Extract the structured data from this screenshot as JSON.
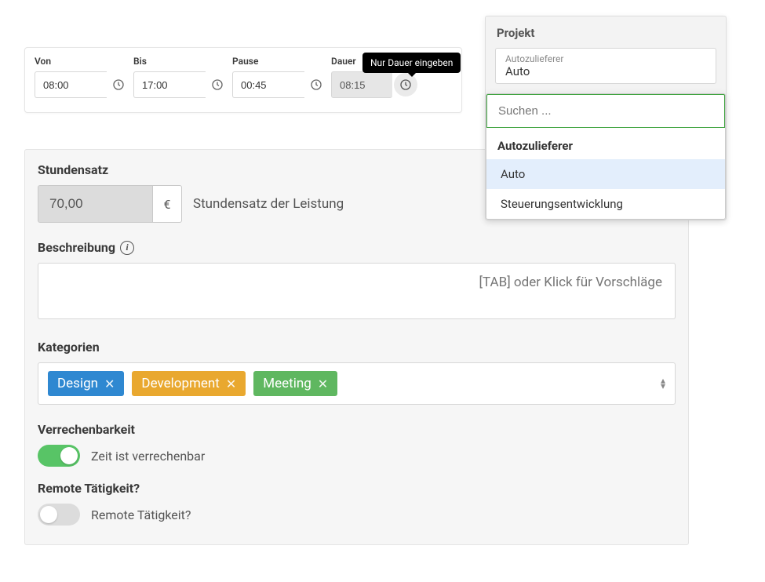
{
  "time": {
    "labels": {
      "von": "Von",
      "bis": "Bis",
      "pause": "Pause",
      "dauer": "Dauer"
    },
    "values": {
      "von": "08:00",
      "bis": "17:00",
      "pause": "00:45",
      "dauer": "08:15"
    },
    "tooltip": "Nur Dauer eingeben"
  },
  "rate": {
    "label": "Stundensatz",
    "value": "70,00",
    "currency": "€",
    "hint": "Stundensatz der Leistung"
  },
  "description": {
    "label": "Beschreibung",
    "placeholder": "[TAB] oder Klick für Vorschläge"
  },
  "categories": {
    "label": "Kategorien",
    "tags": [
      {
        "label": "Design",
        "color": "blue"
      },
      {
        "label": "Development",
        "color": "yellow"
      },
      {
        "label": "Meeting",
        "color": "green"
      }
    ]
  },
  "billable": {
    "label": "Verrechenbarkeit",
    "text": "Zeit ist verrechenbar",
    "on": true
  },
  "remote": {
    "label": "Remote Tätigkeit?",
    "text": "Remote Tätigkeit?",
    "on": false
  },
  "project": {
    "header": "Projekt",
    "selected_sub": "Autozulieferer",
    "selected_main": "Auto",
    "search_placeholder": "Suchen ...",
    "group_title": "Autozulieferer",
    "options": [
      "Auto",
      "Steuerungsentwicklung"
    ],
    "selected_option": "Auto"
  }
}
